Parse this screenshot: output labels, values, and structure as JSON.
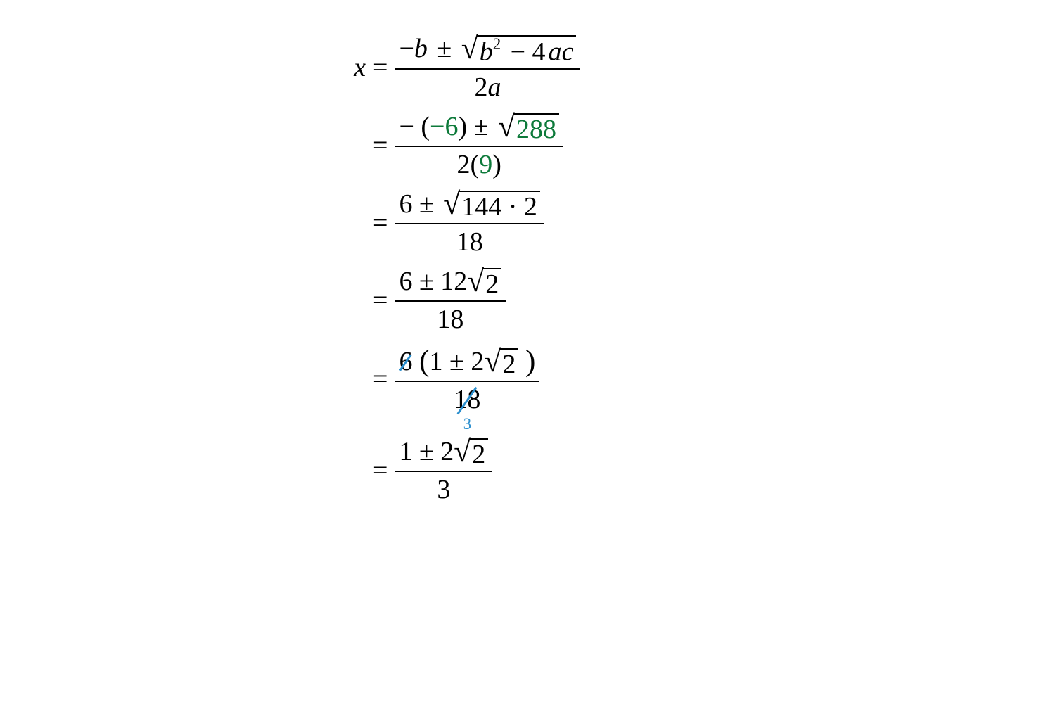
{
  "var": "x",
  "equals": "=",
  "pm": "±",
  "minus": "−",
  "plus": "+",
  "dot": "·",
  "surd": "√",
  "lparen": "(",
  "rparen": ")",
  "row1": {
    "num_prefix": "−",
    "b": "b",
    "sq_b": "b",
    "sq_exp": "2",
    "sq_minus": "− 4",
    "sq_a": "a",
    "sq_c": "c",
    "den_two": "2",
    "den_a": "a"
  },
  "row2": {
    "num_prefix": "− (",
    "neg6": "−6",
    "num_close": ") ±",
    "sqrt_val": "288",
    "den_two": "2(",
    "den_nine": "9",
    "den_close": ")"
  },
  "row3": {
    "num_prefix": "6 ±",
    "sqrt_val": "144 · 2",
    "den": "18"
  },
  "row4": {
    "num_prefix": "6 ± 12",
    "sqrt_val": "2",
    "den": "18"
  },
  "row5": {
    "cancel_num": "6",
    "paren_content_prefix": "1 ± 2",
    "sqrt_val": "2",
    "den": "18",
    "reduced": "3"
  },
  "row6": {
    "num_prefix": "1 ± 2",
    "sqrt_val": "2",
    "den": "3"
  }
}
